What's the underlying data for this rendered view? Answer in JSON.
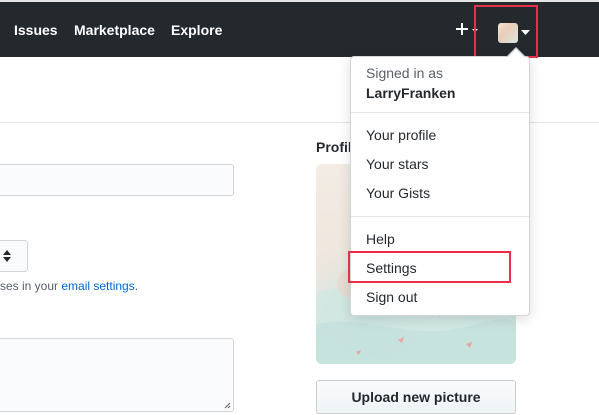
{
  "nav": {
    "links": [
      "Issues",
      "Marketplace",
      "Explore"
    ]
  },
  "icons": {
    "plus": "plus-icon",
    "caret": "caret-down-icon",
    "avatar": "user-avatar",
    "select": "select-arrows-icon",
    "resize": "resize-handle-icon"
  },
  "colors": {
    "header_bg": "#24292e",
    "highlight": "#e8304a",
    "link": "#0366d6"
  },
  "dropdown": {
    "signed_in_label": "Signed in as",
    "username": "LarryFranken",
    "items": [
      "Your profile",
      "Your stars",
      "Your Gists",
      "Help",
      "Settings",
      "Sign out"
    ]
  },
  "form": {
    "helper_text": "ses in your ",
    "helper_link": "email settings",
    "helper_suffix": "."
  },
  "profile": {
    "title": "Profil",
    "upload_button": "Upload new picture"
  }
}
